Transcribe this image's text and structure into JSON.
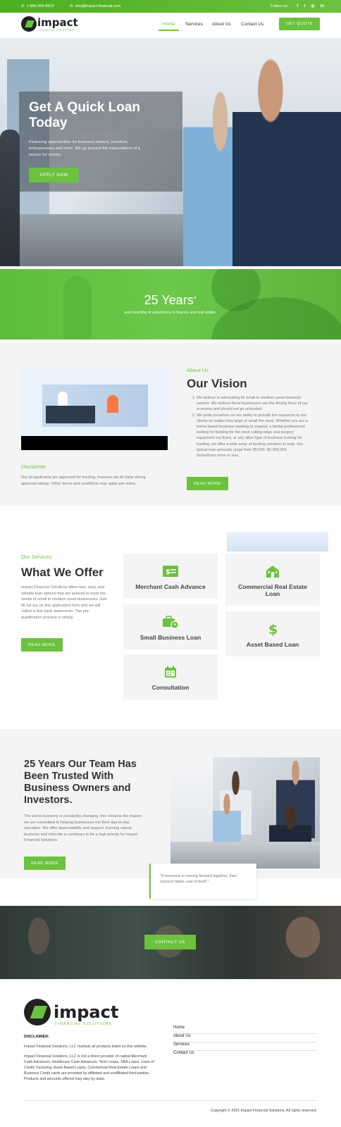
{
  "topbar": {
    "phone": "1-866-305-8910",
    "email": "info@impact-financial.com",
    "follow_label": "Follow Us :",
    "social": [
      "f",
      "t",
      "ig",
      "in"
    ]
  },
  "header": {
    "logo_word": "impact",
    "logo_sub": "FINANCIAL SOLUTIONS",
    "nav": [
      "Home",
      "Services",
      "About Us",
      "Contact Us"
    ],
    "quote_button": "GET QUOTE"
  },
  "hero": {
    "title": "Get A Quick Loan Today",
    "text": "Financing opportunities for business owners, investors, entrepreneurs and more. We go beyond the expectations of a source for money.",
    "button": "APPLY NOW"
  },
  "years": {
    "title": "25 Years",
    "plus": "+",
    "subtitle": "and counting of experience in finance and real estate."
  },
  "about": {
    "eyebrow": "About Us",
    "title": "Our Vision",
    "points": [
      "We believe in advocating for small to medium sized business owners. We believe these businesses are the driving force of our economy and should not go unfunded.",
      "We pride ourselves on our ability to provide the resources to our clients no matter how large or small the need. Whether you are a home-based business seeking to expand, a dental professional looking for funding for the most cutting-edge oral surgery equipment out there, or any other type of business looking for funding, we offer a wide array of funding solutions to help. Our typical loan amounts range from $5,000- $2,000,000. Sometimes more or less."
    ],
    "button": "READ MORE",
    "disclaimer_title": "Disclaimer",
    "disclaimer_text": "Not all applicants are approved for funding, however we do have strong approval ratings. Other terms and conditions may apply per video."
  },
  "services": {
    "eyebrow": "Our Services",
    "title": "What We Offer",
    "text": "Impact Financial Solutions offers fast, easy, and reliable loan options that are tailored to meet the needs of small to medium sized businesses. Just fill out our on line application form and we will collect a few bank statements. The pre-qualification process is simply.",
    "button": "READ MORE",
    "cards": [
      {
        "label": "Merchant Cash Advance",
        "icon": "cash-icon"
      },
      {
        "label": "Commercial Real Estate Loan",
        "icon": "building-icon"
      },
      {
        "label": "Small Business Loan",
        "icon": "briefcase-icon"
      },
      {
        "label": "Asset Based Loan",
        "icon": "dollar-icon"
      },
      {
        "label": "Consultation",
        "icon": "calendar-icon"
      }
    ]
  },
  "team": {
    "title": "25 Years Our Team Has Been Trusted With Business Owners and Investors.",
    "text": "The world economy is constantly changing, this remains the reason we are committed to helping businesses run their day-to-day operation. We offer dependability and support. Earning repeat business and referrals is continues to be a high priority for Impact Financial Solutions.",
    "button": "READ MORE",
    "quote": "\"If everyone is moving forward together, then success takes care of itself.\""
  },
  "contact": {
    "button": "CONTACT US"
  },
  "footer": {
    "logo_word": "impact",
    "logo_sub": "FINANCIAL SOLUTIONS",
    "disclaimer_title": "DISCLAIMER:",
    "disclaimer_p1": "Impact Financial Solutions, LLC markets all products listed on this website.",
    "disclaimer_p2": "Impact Financial Solutions, LLC is not a direct provider of capital Merchant Cash Advances, Healthcare Cash Advances, Term Loans, SBA Loans, Lines of Credit, Factoring, Asset Based Loans, Commercial Real Estate Loans and Business Credit cards are provided by affiliated and unaffiliated third parties. Products and amounts offered may vary by state.",
    "links": [
      "Home",
      "About Us",
      "Services",
      "Contact Us"
    ],
    "copyright": "Copyright © 2021 Impact Financial Solutions. All rights reserved."
  },
  "colors": {
    "accent": "#6cc23f",
    "topbar": "#4caf1e",
    "text": "#333333",
    "muted": "#777777"
  }
}
